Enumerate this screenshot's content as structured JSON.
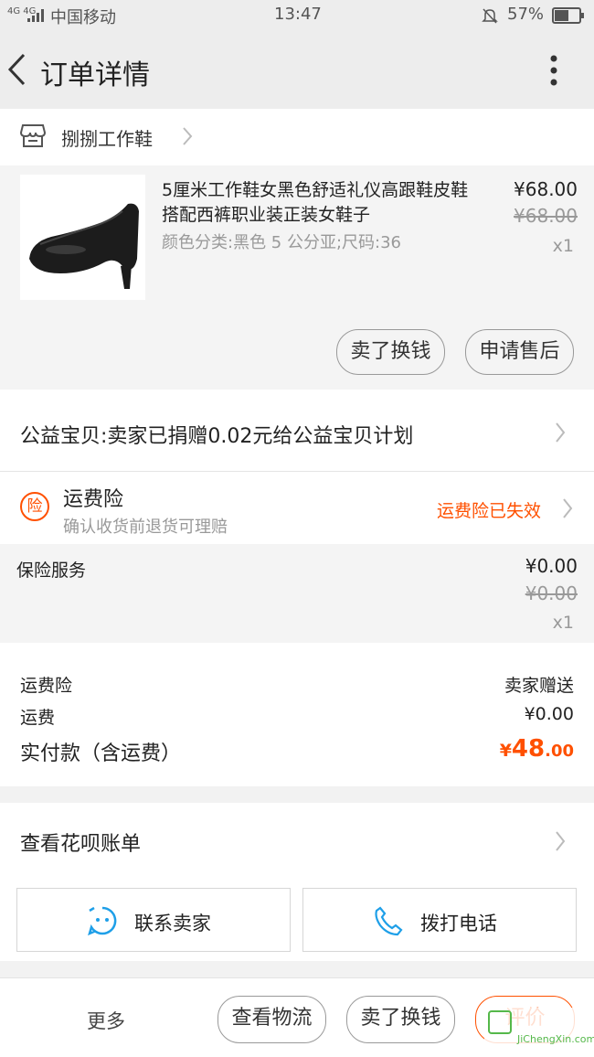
{
  "status_bar": {
    "network": "4G 4G",
    "carrier": "中国移动",
    "time": "13:47",
    "battery": "57%"
  },
  "header": {
    "title": "订单详情"
  },
  "shop": {
    "name": "捌捌工作鞋"
  },
  "product": {
    "title": "5厘米工作鞋女黑色舒适礼仪高跟鞋皮鞋搭配西裤职业装正装女鞋子",
    "variant": "颜色分类:黑色 5 公分亚;尺码:36",
    "price": "¥68.00",
    "original_price": "¥68.00",
    "quantity": "x1",
    "btn_sell": "卖了换钱",
    "btn_after_sale": "申请售后"
  },
  "charity": {
    "text": "公益宝贝:卖家已捐赠0.02元给公益宝贝计划"
  },
  "insurance": {
    "badge": "险",
    "title": "运费险",
    "subtitle": "确认收货前退货可理赔",
    "status": "运费险已失效"
  },
  "service": {
    "label": "保险服务",
    "price": "¥0.00",
    "original_price": "¥0.00",
    "quantity": "x1"
  },
  "summary": {
    "row1_label": "运费险",
    "row1_value": "卖家赠送",
    "row2_label": "运费",
    "row2_value": "¥0.00",
    "total_label": "实付款（含运费）",
    "total_symbol": "¥",
    "total_int": "48",
    "total_dec": ".00"
  },
  "huabei": {
    "label": "查看花呗账单"
  },
  "contact": {
    "seller": "联系卖家",
    "phone": "拨打电话"
  },
  "bottom": {
    "more": "更多",
    "logistics": "查看物流",
    "sell": "卖了换钱",
    "review": "评价"
  },
  "watermark": {
    "text": "JiChengXin.com"
  },
  "colors": {
    "accent": "#ff5000",
    "icon_blue": "#1e9fe8"
  }
}
